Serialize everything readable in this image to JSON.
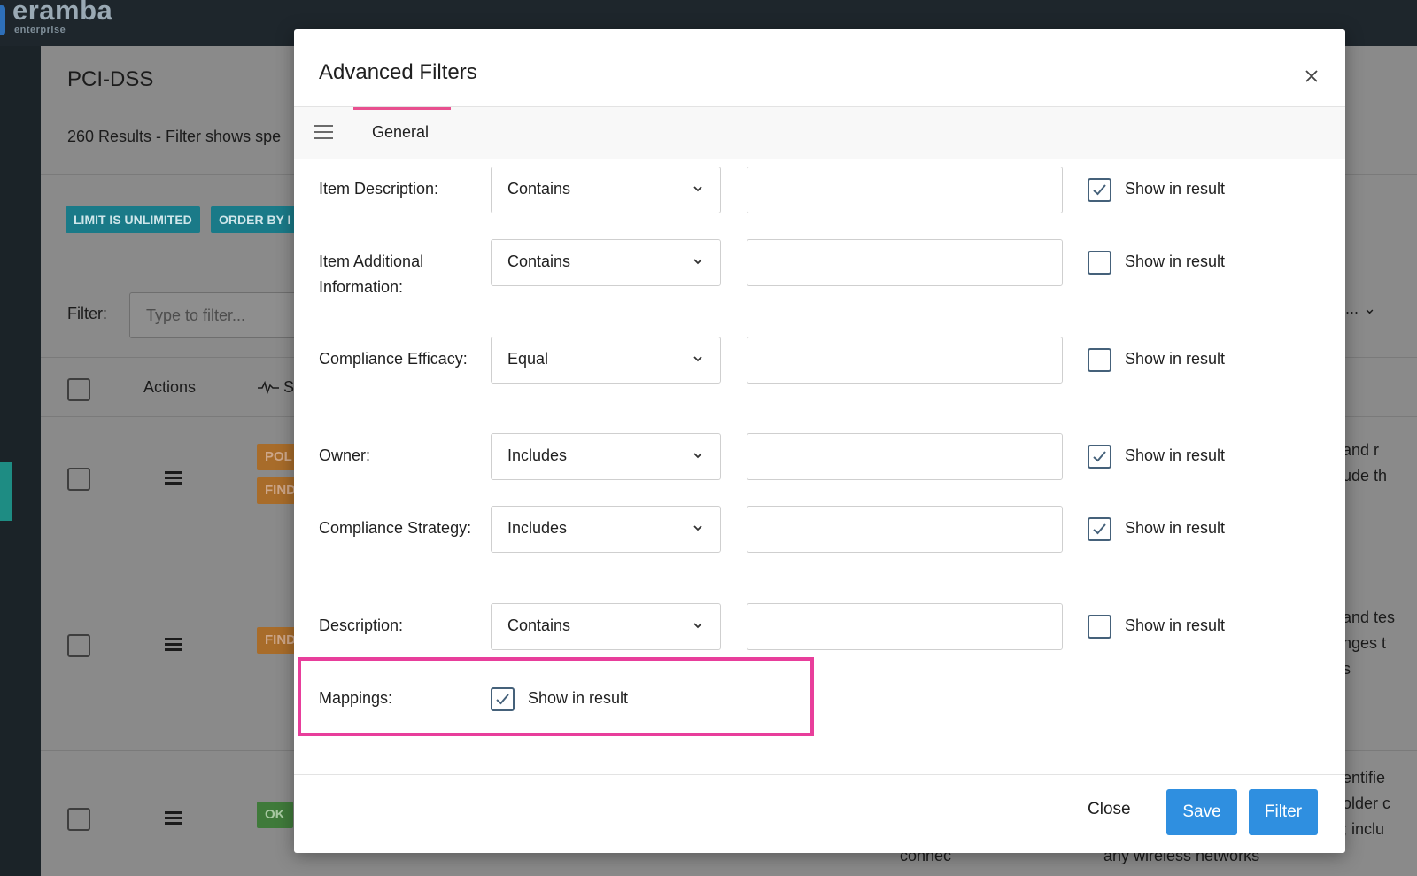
{
  "app": {
    "logo": "eramba",
    "logo_sub": "enterprise"
  },
  "background": {
    "page_title": "PCI-DSS",
    "results_text": "260 Results - Filter shows spe",
    "badges": [
      "LIMIT IS UNLIMITED",
      "ORDER BY I"
    ],
    "filter_label": "Filter:",
    "filter_placeholder": "Type to filter...",
    "filter_right_select": "5...",
    "columns": {
      "actions": "Actions",
      "status": "S"
    },
    "row_tags": {
      "row1": [
        "POL",
        "FIND"
      ],
      "row2": [
        "FIND"
      ],
      "row3": [
        "OK"
      ]
    },
    "right_text": {
      "row1": [
        "and r",
        "ude th"
      ],
      "row2": [
        "and tes",
        "nges t",
        "s"
      ],
      "row3": [
        "entifie",
        "older c",
        "; inclu"
      ]
    },
    "bottom_text": [
      "connec",
      "any wireless networks"
    ]
  },
  "modal": {
    "title": "Advanced Filters",
    "tab_label": "General",
    "rows": [
      {
        "label": "Item Description:",
        "operator": "Contains",
        "value": "",
        "show_label": "Show in result",
        "checked": true
      },
      {
        "label": "Item Additional Information:",
        "operator": "Contains",
        "value": "",
        "show_label": "Show in result",
        "checked": false
      },
      {
        "label": "Compliance Efficacy:",
        "operator": "Equal",
        "value": "",
        "show_label": "Show in result",
        "checked": false
      },
      {
        "label": "Owner:",
        "operator": "Includes",
        "value": "",
        "show_label": "Show in result",
        "checked": true
      },
      {
        "label": "Compliance Strategy:",
        "operator": "Includes",
        "value": "",
        "show_label": "Show in result",
        "checked": true
      },
      {
        "label": "Description:",
        "operator": "Contains",
        "value": "",
        "show_label": "Show in result",
        "checked": false
      }
    ],
    "mappings": {
      "label": "Mappings:",
      "show_label": "Show in result",
      "checked": true
    },
    "footer": {
      "close": "Close",
      "save": "Save",
      "filter": "Filter"
    }
  },
  "colors": {
    "accent": "#2f8fe0",
    "tab_indicator": "#e8508f",
    "highlight": "#e83e9b",
    "checkbox_border": "#45617a"
  }
}
